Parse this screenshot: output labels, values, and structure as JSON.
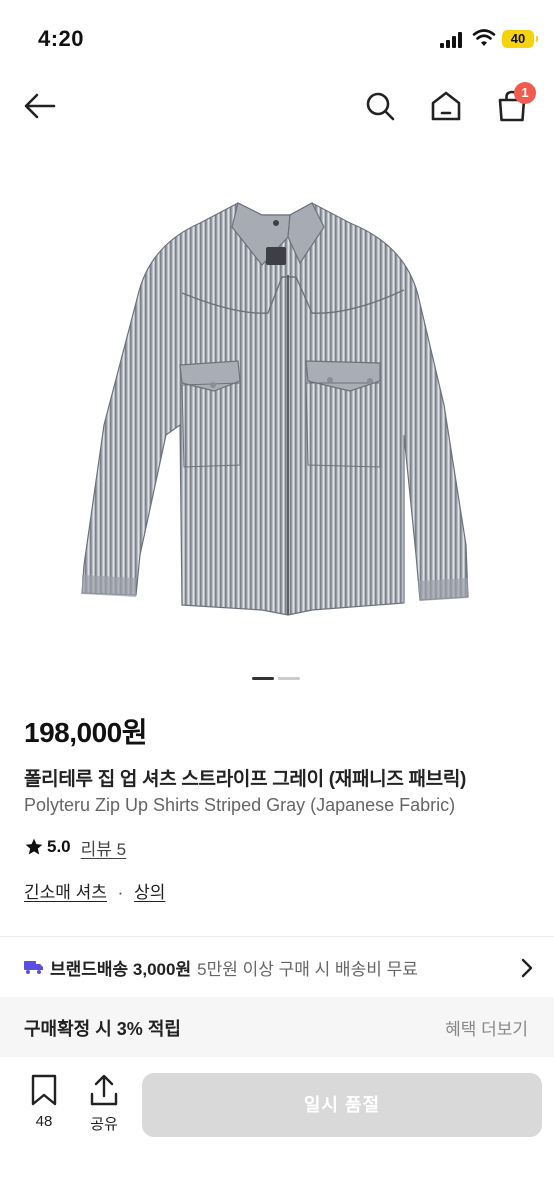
{
  "status_bar": {
    "time": "4:20",
    "battery": "40"
  },
  "nav": {
    "cart_count": "1"
  },
  "product": {
    "price": "198,000원",
    "title_ko": "폴리테루 집 업 셔츠 스트라이프 그레이 (재패니즈 패브릭)",
    "title_en": "Polyteru Zip Up Shirts Striped Gray (Japanese Fabric)",
    "rating": "5.0",
    "review_label": "리뷰 5",
    "category_primary": "긴소매 셔츠",
    "category_separator": "·",
    "category_secondary": "상의",
    "image_count": 2,
    "image_index": 1
  },
  "shipping": {
    "label": "브랜드배송 3,000원",
    "note": "5만원 이상 구매 시 배송비 무료"
  },
  "benefit": {
    "label": "구매확정 시 3% 적립",
    "more": "혜택 더보기"
  },
  "bottom_bar": {
    "bookmark_count": "48",
    "share_label": "공유",
    "sold_out_label": "일시 품절"
  },
  "colors": {
    "accent": "#f05a4f",
    "disabled_button": "#d9d9d9",
    "truck": "#5b4fe0",
    "battery": "#f5d40f"
  }
}
